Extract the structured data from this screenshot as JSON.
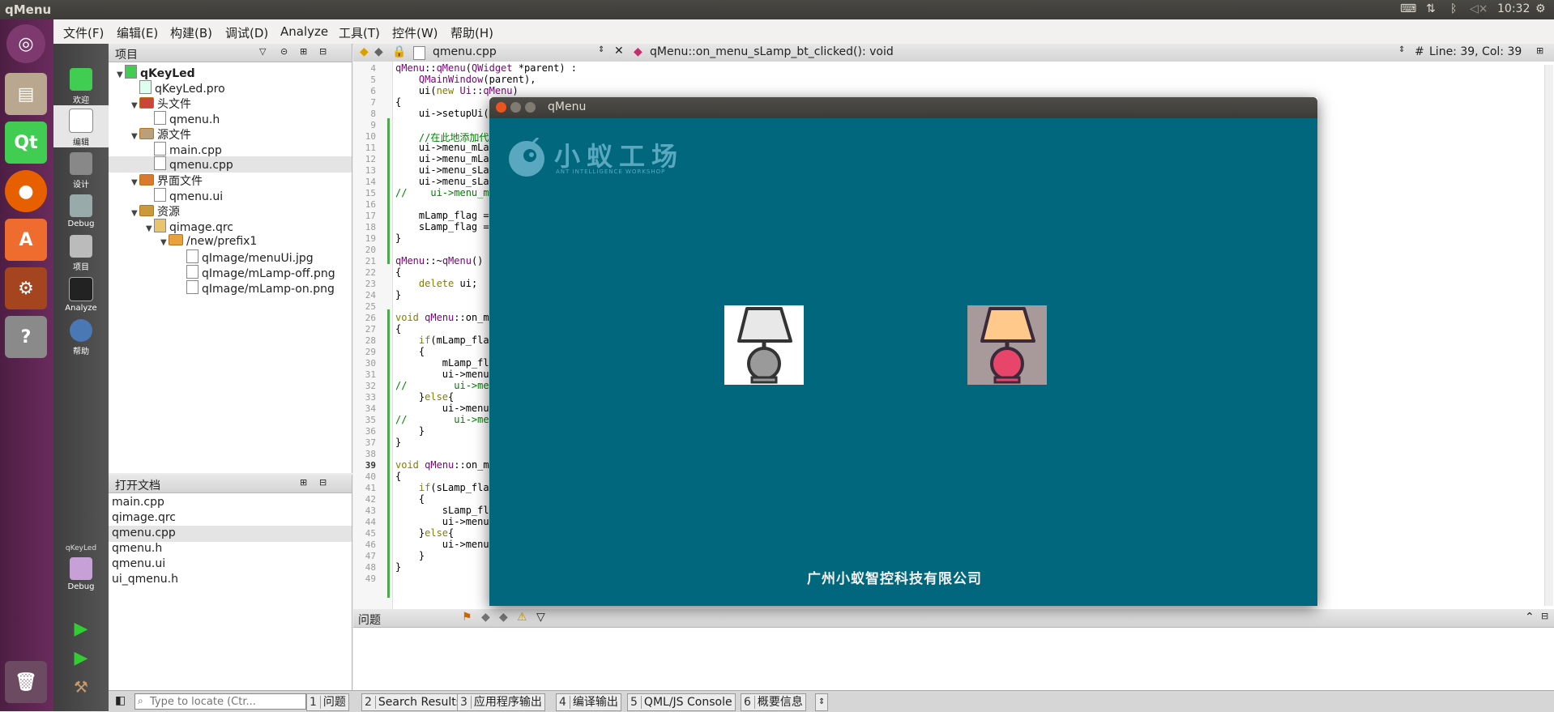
{
  "topbar": {
    "app_title": "qMenu",
    "time": "10:32"
  },
  "menubar": {
    "items": [
      "文件(F)",
      "编辑(E)",
      "构建(B)",
      "调试(D)",
      "Analyze",
      "工具(T)",
      "控件(W)",
      "帮助(H)"
    ]
  },
  "modes": {
    "welcome": "欢迎",
    "edit": "编辑",
    "design": "设计",
    "debug": "Debug",
    "projects": "项目",
    "analyze": "Analyze",
    "help": "帮助",
    "kit_name": "qKeyLed",
    "kit_config": "Debug"
  },
  "project_panel": {
    "title": "项目",
    "tree": [
      {
        "label": "qKeyLed",
        "level": 0
      },
      {
        "label": "qKeyLed.pro",
        "level": 1
      },
      {
        "label": "头文件",
        "level": 1
      },
      {
        "label": "qmenu.h",
        "level": 2
      },
      {
        "label": "源文件",
        "level": 1
      },
      {
        "label": "main.cpp",
        "level": 2
      },
      {
        "label": "qmenu.cpp",
        "level": 2
      },
      {
        "label": "界面文件",
        "level": 1
      },
      {
        "label": "qmenu.ui",
        "level": 2
      },
      {
        "label": "资源",
        "level": 1
      },
      {
        "label": "qimage.qrc",
        "level": 2
      },
      {
        "label": "/new/prefix1",
        "level": 3
      },
      {
        "label": "qImage/menuUi.jpg",
        "level": 4
      },
      {
        "label": "qImage/mLamp-off.png",
        "level": 4
      },
      {
        "label": "qImage/mLamp-on.png",
        "level": 4
      }
    ]
  },
  "open_docs": {
    "title": "打开文档",
    "items": [
      "main.cpp",
      "qimage.qrc",
      "qmenu.cpp",
      "qmenu.h",
      "qmenu.ui",
      "ui_qmenu.h"
    ],
    "selected": "qmenu.cpp"
  },
  "editor": {
    "file": "qmenu.cpp",
    "function": "qMenu::on_menu_sLamp_bt_clicked(): void",
    "position": "Line: 39, Col: 39",
    "line_numbers": [
      "4",
      "5",
      "6",
      "7",
      "8",
      "9",
      "10",
      "11",
      "12",
      "13",
      "14",
      "15",
      "16",
      "17",
      "18",
      "19",
      "20",
      "21",
      "22",
      "23",
      "24",
      "25",
      "26",
      "27",
      "28",
      "29",
      "30",
      "31",
      "32",
      "33",
      "34",
      "35",
      "36",
      "37",
      "38",
      "39",
      "40",
      "41",
      "42",
      "43",
      "44",
      "45",
      "46",
      "47",
      "48",
      "49"
    ],
    "lines": [
      "qMenu::qMenu(QWidget *parent) :",
      "    QMainWindow(parent),",
      "    ui(new Ui::qMenu)",
      "{",
      "    ui->setupUi(",
      "",
      "    //在此地添加代",
      "    ui->menu_mLa",
      "    ui->menu_mLa",
      "    ui->menu_sLa",
      "    ui->menu_sLa",
      "//    ui->menu_m",
      "",
      "    mLamp_flag =",
      "    sLamp_flag =",
      "}",
      "",
      "qMenu::~qMenu()",
      "{",
      "    delete ui;",
      "}",
      "",
      "void qMenu::on_m",
      "{",
      "    if(mLamp_fla",
      "    {",
      "        mLamp_fl",
      "        ui->menu",
      "//        ui->me",
      "    }else{",
      "        ui->menu",
      "//        ui->me",
      "    }",
      "}",
      "",
      "void qMenu::on_m",
      "{",
      "    if(sLamp_fla",
      "    {",
      "        sLamp_fl",
      "        ui->menu",
      "    }else{",
      "        ui->menu",
      "    }",
      "}",
      ""
    ]
  },
  "issues": {
    "title": "问题"
  },
  "bottombar": {
    "locate_placeholder": "Type to locate (Ctr...",
    "tabs": [
      {
        "num": "1",
        "label": "问题"
      },
      {
        "num": "2",
        "label": "Search Results"
      },
      {
        "num": "3",
        "label": "应用程序输出"
      },
      {
        "num": "4",
        "label": "编译输出"
      },
      {
        "num": "5",
        "label": "QML/JS Console"
      },
      {
        "num": "6",
        "label": "概要信息"
      }
    ]
  },
  "qmenu_window": {
    "title": "qMenu",
    "logo_cn": "小蚁工场",
    "logo_en": "ANT INTELLIGENCE WORKSHOP",
    "footer": "广州小蚁智控科技有限公司",
    "bg_color": "#00677c",
    "lamp_off": "desk-lamp-off-icon",
    "lamp_on": "desk-lamp-on-icon"
  }
}
